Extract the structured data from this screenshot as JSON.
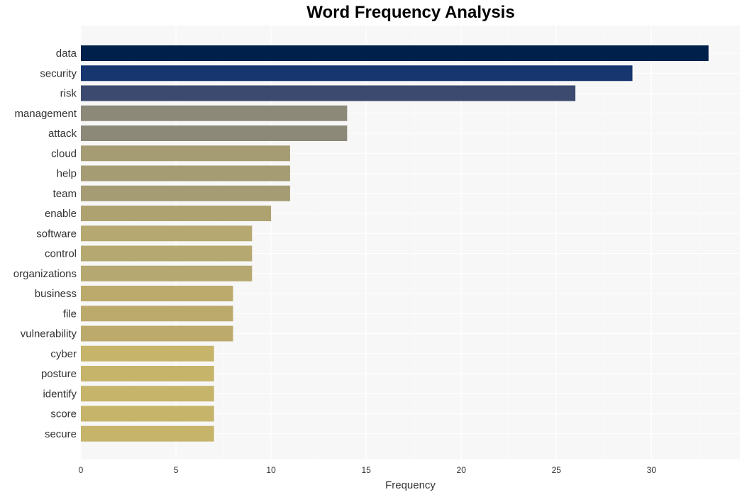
{
  "chart_data": {
    "type": "bar",
    "orientation": "horizontal",
    "title": "Word Frequency Analysis",
    "xlabel": "Frequency",
    "ylabel": "",
    "xlim": [
      0,
      34.65
    ],
    "xticks": [
      0,
      5,
      10,
      15,
      20,
      25,
      30
    ],
    "grid": true,
    "categories": [
      "data",
      "security",
      "risk",
      "management",
      "attack",
      "cloud",
      "help",
      "team",
      "enable",
      "software",
      "control",
      "organizations",
      "business",
      "file",
      "vulnerability",
      "cyber",
      "posture",
      "identify",
      "score",
      "secure"
    ],
    "values": [
      33,
      29,
      26,
      14,
      14,
      11,
      11,
      11,
      10,
      9,
      9,
      9,
      8,
      8,
      8,
      7,
      7,
      7,
      7,
      7
    ],
    "colors": [
      "#00204c",
      "#17366f",
      "#3b4a6e",
      "#8d8979",
      "#8d8979",
      "#a59c74",
      "#a59c74",
      "#a59c74",
      "#aea271",
      "#b5a870",
      "#b5a870",
      "#b5a870",
      "#bca96c",
      "#bca96c",
      "#bca96c",
      "#c5b46a",
      "#c5b46a",
      "#c5b46a",
      "#c5b46a",
      "#c5b46a"
    ],
    "background": "#f7f7f7",
    "gridline_color": "#ffffff"
  }
}
